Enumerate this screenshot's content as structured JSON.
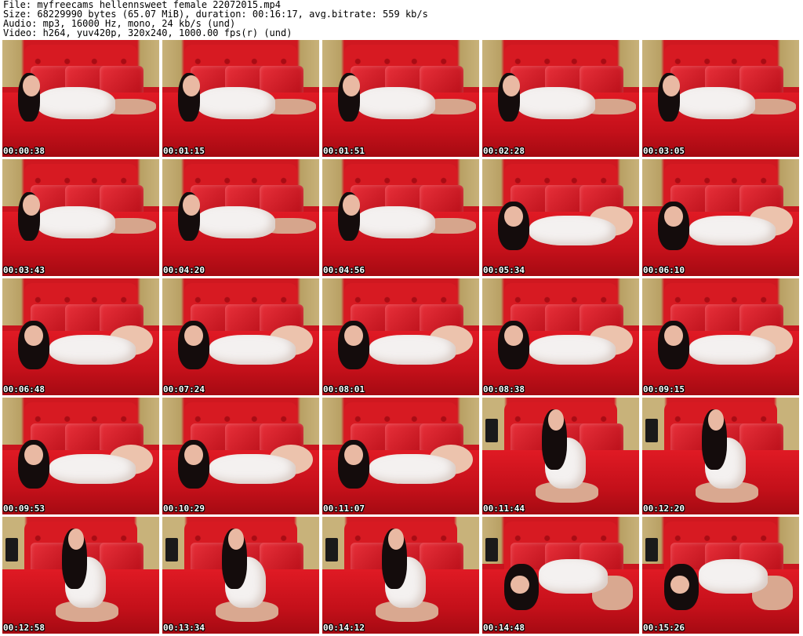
{
  "header": {
    "file": "File: myfreecams_hellennsweet_female_22072015.mp4",
    "size": "Size: 68229990 bytes (65.07 MiB), duration: 00:16:17, avg.bitrate: 559 kb/s",
    "audio": "Audio: mp3, 16000 Hz, mono, 24 kb/s (und)",
    "video": "Video: h264, yuv420p, 320x240, 1000.00 fps(r) (und)"
  },
  "thumbnails": [
    {
      "timestamp": "00:00:38",
      "scene": "lying"
    },
    {
      "timestamp": "00:01:15",
      "scene": "lying"
    },
    {
      "timestamp": "00:01:51",
      "scene": "lying"
    },
    {
      "timestamp": "00:02:28",
      "scene": "lying"
    },
    {
      "timestamp": "00:03:05",
      "scene": "lying"
    },
    {
      "timestamp": "00:03:43",
      "scene": "lying"
    },
    {
      "timestamp": "00:04:20",
      "scene": "lying"
    },
    {
      "timestamp": "00:04:56",
      "scene": "lying"
    },
    {
      "timestamp": "00:05:34",
      "scene": "prone"
    },
    {
      "timestamp": "00:06:10",
      "scene": "prone"
    },
    {
      "timestamp": "00:06:48",
      "scene": "prone"
    },
    {
      "timestamp": "00:07:24",
      "scene": "prone"
    },
    {
      "timestamp": "00:08:01",
      "scene": "prone"
    },
    {
      "timestamp": "00:08:38",
      "scene": "prone"
    },
    {
      "timestamp": "00:09:15",
      "scene": "prone"
    },
    {
      "timestamp": "00:09:53",
      "scene": "prone"
    },
    {
      "timestamp": "00:10:29",
      "scene": "prone"
    },
    {
      "timestamp": "00:11:07",
      "scene": "prone"
    },
    {
      "timestamp": "00:11:44",
      "scene": "kneel"
    },
    {
      "timestamp": "00:12:20",
      "scene": "kneel"
    },
    {
      "timestamp": "00:12:58",
      "scene": "kneel"
    },
    {
      "timestamp": "00:13:34",
      "scene": "kneel"
    },
    {
      "timestamp": "00:14:12",
      "scene": "kneel"
    },
    {
      "timestamp": "00:14:48",
      "scene": "crawl"
    },
    {
      "timestamp": "00:15:26",
      "scene": "crawl"
    }
  ],
  "colors": {
    "background": "#ffffff",
    "bed_red": "#c9141e",
    "timestamp_text": "#ffffff"
  }
}
